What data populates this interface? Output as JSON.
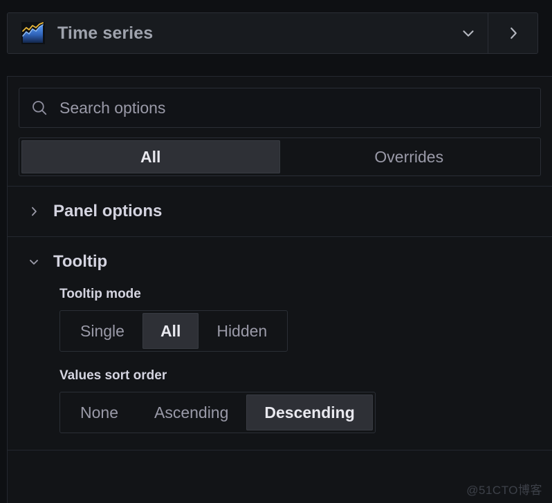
{
  "viz_picker": {
    "title": "Time series",
    "icon": "time-series-chart-icon",
    "dropdown_icon": "chevron-down-icon",
    "collapse_icon": "chevron-right-icon"
  },
  "search": {
    "placeholder": "Search options",
    "value": "",
    "icon": "search-icon"
  },
  "tabs": [
    {
      "label": "All",
      "active": true
    },
    {
      "label": "Overrides",
      "active": false
    }
  ],
  "sections": [
    {
      "title": "Panel options",
      "expanded": false,
      "chevron": "chevron-right-icon"
    },
    {
      "title": "Tooltip",
      "expanded": true,
      "chevron": "chevron-down-icon",
      "fields": [
        {
          "label": "Tooltip mode",
          "type": "radio-group",
          "options": [
            "Single",
            "All",
            "Hidden"
          ],
          "selected": "All"
        },
        {
          "label": "Values sort order",
          "type": "radio-group",
          "options": [
            "None",
            "Ascending",
            "Descending"
          ],
          "selected": "Descending"
        }
      ]
    }
  ],
  "watermark": "@51CTO博客",
  "colors": {
    "page_bg": "#0e1013",
    "panel_bg": "#181b1f",
    "field_bg": "#121417",
    "border": "#2b2f36",
    "divider": "#24282f",
    "text_primary": "#d4d4e0",
    "text_secondary": "#9a9aa8",
    "selected_bg": "#2e3036",
    "icon_line": "#eab839",
    "icon_area": "#3274d9"
  }
}
